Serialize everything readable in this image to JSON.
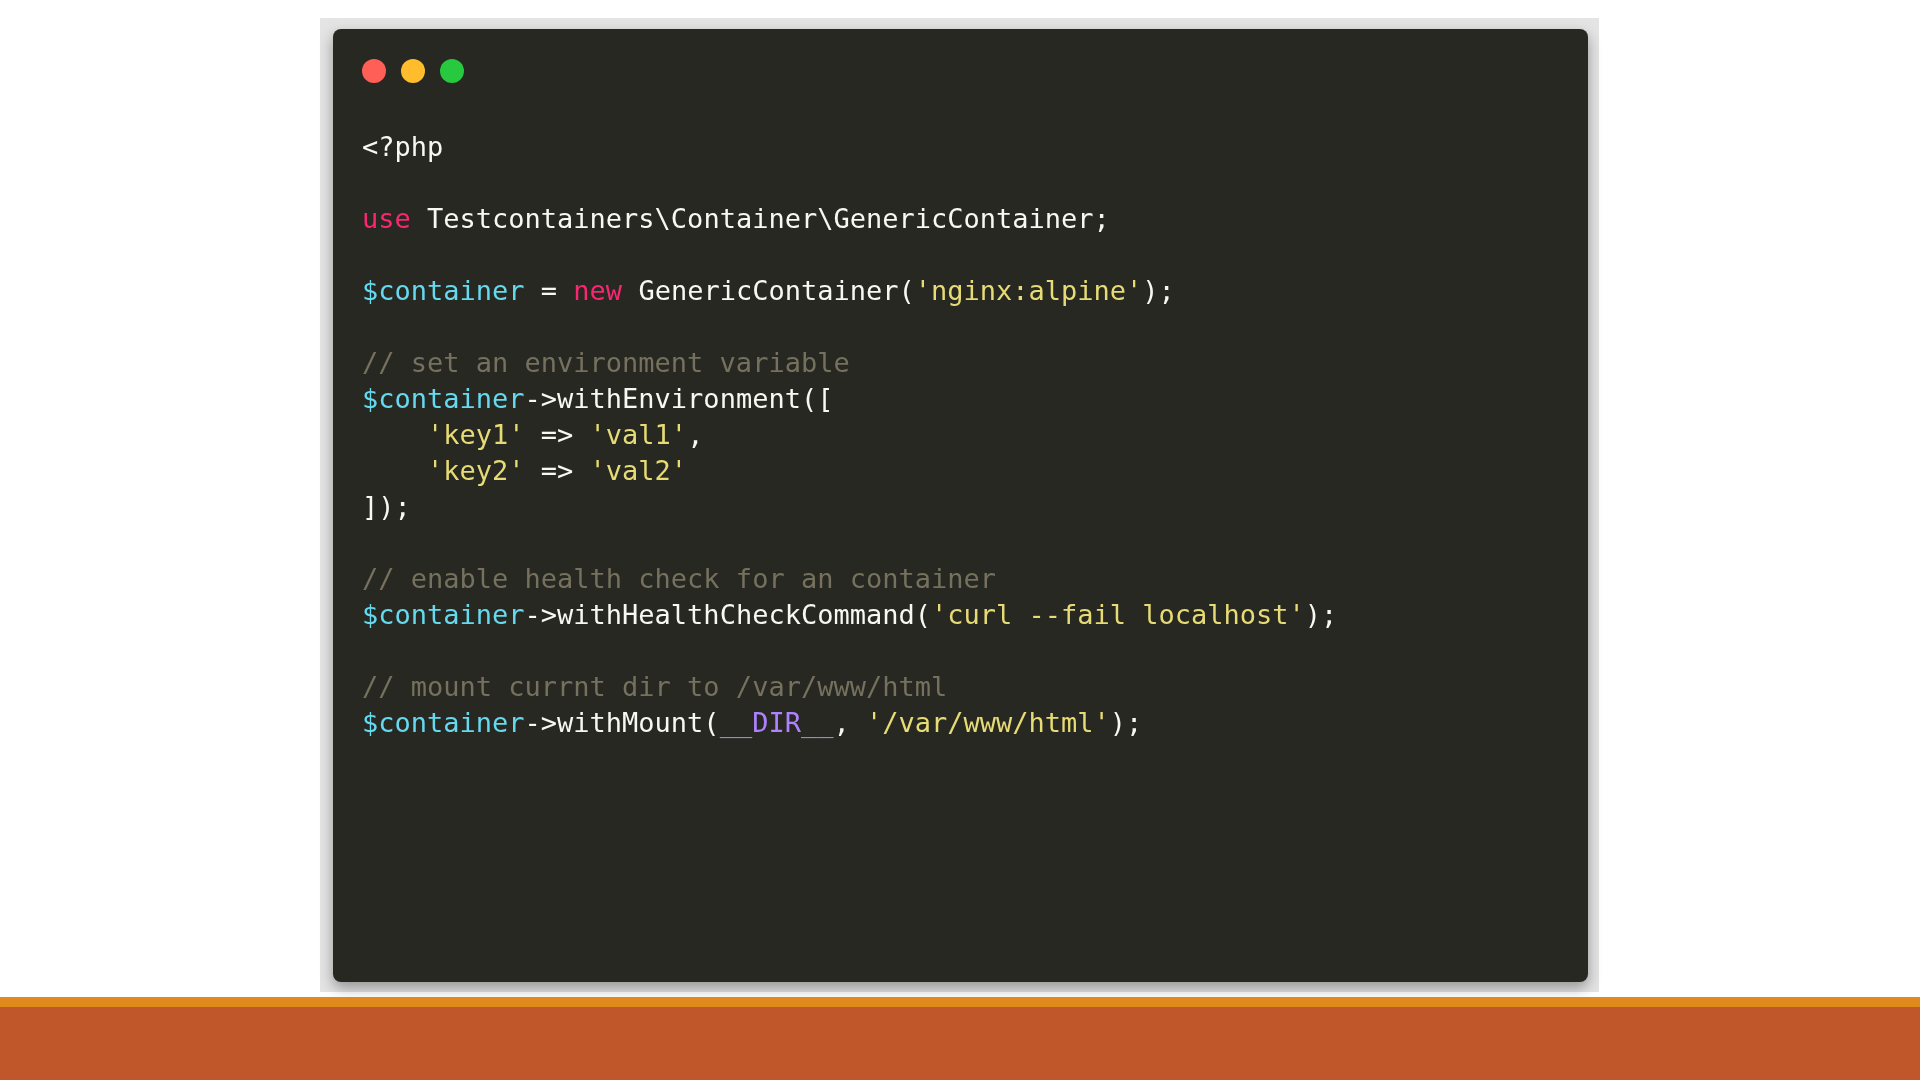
{
  "code_window": {
    "lines": [
      {
        "kind": "code",
        "tokens": [
          {
            "kind": "plain",
            "text": "<?php"
          }
        ]
      },
      {
        "kind": "blank"
      },
      {
        "kind": "code",
        "tokens": [
          {
            "kind": "keyword",
            "text": "use"
          },
          {
            "kind": "plain",
            "text": " Testcontainers\\Container\\GenericContainer;"
          }
        ]
      },
      {
        "kind": "blank"
      },
      {
        "kind": "code",
        "tokens": [
          {
            "kind": "variable",
            "text": "$container"
          },
          {
            "kind": "plain",
            "text": " = "
          },
          {
            "kind": "keyword",
            "text": "new"
          },
          {
            "kind": "plain",
            "text": " GenericContainer("
          },
          {
            "kind": "string",
            "text": "'nginx:alpine'"
          },
          {
            "kind": "plain",
            "text": ");"
          }
        ]
      },
      {
        "kind": "blank"
      },
      {
        "kind": "code",
        "tokens": [
          {
            "kind": "comment",
            "text": "// set an environment variable"
          }
        ]
      },
      {
        "kind": "code",
        "tokens": [
          {
            "kind": "variable",
            "text": "$container"
          },
          {
            "kind": "plain",
            "text": "->withEnvironment(["
          }
        ]
      },
      {
        "kind": "code",
        "indented": true,
        "tokens": [
          {
            "kind": "string",
            "text": "'key1'"
          },
          {
            "kind": "plain",
            "text": " => "
          },
          {
            "kind": "string",
            "text": "'val1'"
          },
          {
            "kind": "plain",
            "text": ","
          }
        ]
      },
      {
        "kind": "code",
        "indented": true,
        "tokens": [
          {
            "kind": "string",
            "text": "'key2'"
          },
          {
            "kind": "plain",
            "text": " => "
          },
          {
            "kind": "string",
            "text": "'val2'"
          }
        ]
      },
      {
        "kind": "code",
        "tokens": [
          {
            "kind": "plain",
            "text": "]);"
          }
        ]
      },
      {
        "kind": "blank"
      },
      {
        "kind": "code",
        "tokens": [
          {
            "kind": "comment",
            "text": "// enable health check for an container"
          }
        ]
      },
      {
        "kind": "code",
        "tokens": [
          {
            "kind": "variable",
            "text": "$container"
          },
          {
            "kind": "plain",
            "text": "->withHealthCheckCommand("
          },
          {
            "kind": "string",
            "text": "'curl --fail localhost'"
          },
          {
            "kind": "plain",
            "text": ");"
          }
        ]
      },
      {
        "kind": "blank"
      },
      {
        "kind": "code",
        "tokens": [
          {
            "kind": "comment",
            "text": "// mount currnt dir to /var/www/html"
          }
        ]
      },
      {
        "kind": "code",
        "tokens": [
          {
            "kind": "variable",
            "text": "$container"
          },
          {
            "kind": "plain",
            "text": "->withMount("
          },
          {
            "kind": "constant",
            "text": "__DIR__"
          },
          {
            "kind": "plain",
            "text": ", "
          },
          {
            "kind": "string",
            "text": "'/var/www/html'"
          },
          {
            "kind": "plain",
            "text": ");"
          }
        ]
      }
    ]
  }
}
